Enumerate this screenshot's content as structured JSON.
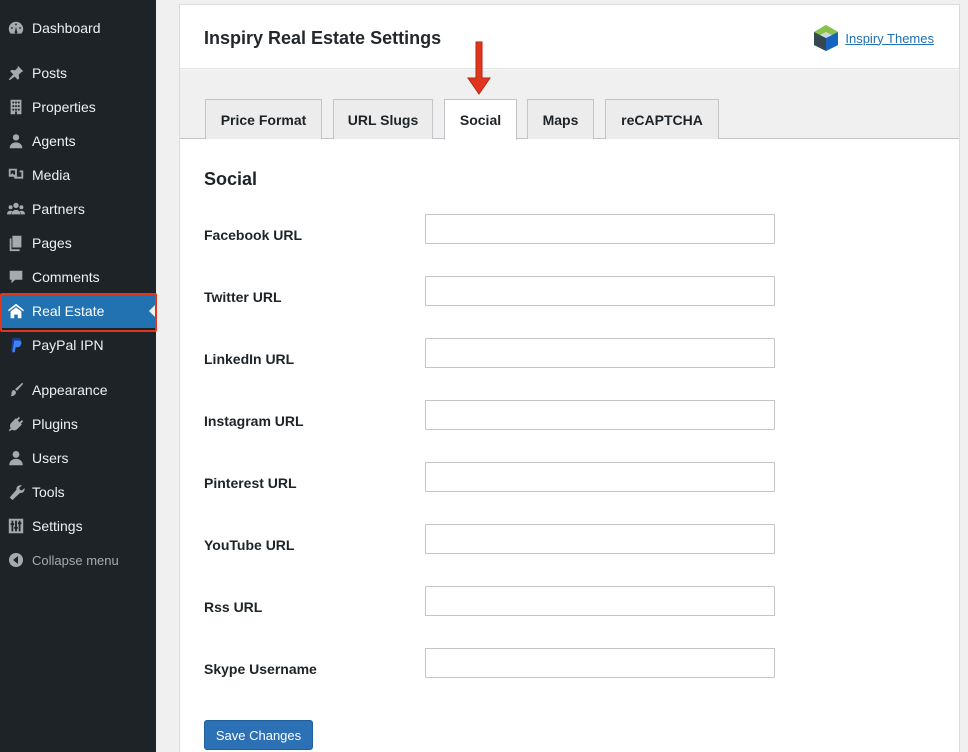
{
  "sidebar": {
    "items": [
      {
        "label": "Dashboard",
        "icon": "dashboard-icon"
      },
      {
        "label": "Posts",
        "icon": "pin-icon"
      },
      {
        "label": "Properties",
        "icon": "building-icon"
      },
      {
        "label": "Agents",
        "icon": "person-icon"
      },
      {
        "label": "Media",
        "icon": "media-icon"
      },
      {
        "label": "Partners",
        "icon": "group-icon"
      },
      {
        "label": "Pages",
        "icon": "pages-icon"
      },
      {
        "label": "Comments",
        "icon": "comment-icon"
      },
      {
        "label": "Real Estate",
        "icon": "houses-icon"
      },
      {
        "label": "PayPal IPN",
        "icon": "paypal-icon"
      },
      {
        "label": "Appearance",
        "icon": "brush-icon"
      },
      {
        "label": "Plugins",
        "icon": "plug-icon"
      },
      {
        "label": "Users",
        "icon": "user-icon"
      },
      {
        "label": "Tools",
        "icon": "wrench-icon"
      },
      {
        "label": "Settings",
        "icon": "sliders-icon"
      }
    ],
    "collapse_label": "Collapse menu",
    "active_color": "#2271b1",
    "highlight_color": "#e0351f"
  },
  "header": {
    "title": "Inspiry Real Estate Settings",
    "brand_label": "Inspiry Themes"
  },
  "tabs": [
    {
      "label": "Price Format"
    },
    {
      "label": "URL Slugs"
    },
    {
      "label": "Social"
    },
    {
      "label": "Maps"
    },
    {
      "label": "reCAPTCHA"
    }
  ],
  "active_tab": "Social",
  "section": {
    "title": "Social",
    "fields": [
      {
        "label": "Facebook URL",
        "value": ""
      },
      {
        "label": "Twitter URL",
        "value": ""
      },
      {
        "label": "LinkedIn URL",
        "value": ""
      },
      {
        "label": "Instagram URL",
        "value": ""
      },
      {
        "label": "Pinterest URL",
        "value": ""
      },
      {
        "label": "YouTube URL",
        "value": ""
      },
      {
        "label": "Rss URL",
        "value": ""
      },
      {
        "label": "Skype Username",
        "value": ""
      }
    ]
  },
  "save_label": "Save Changes",
  "arrow_color": "#e0351f"
}
